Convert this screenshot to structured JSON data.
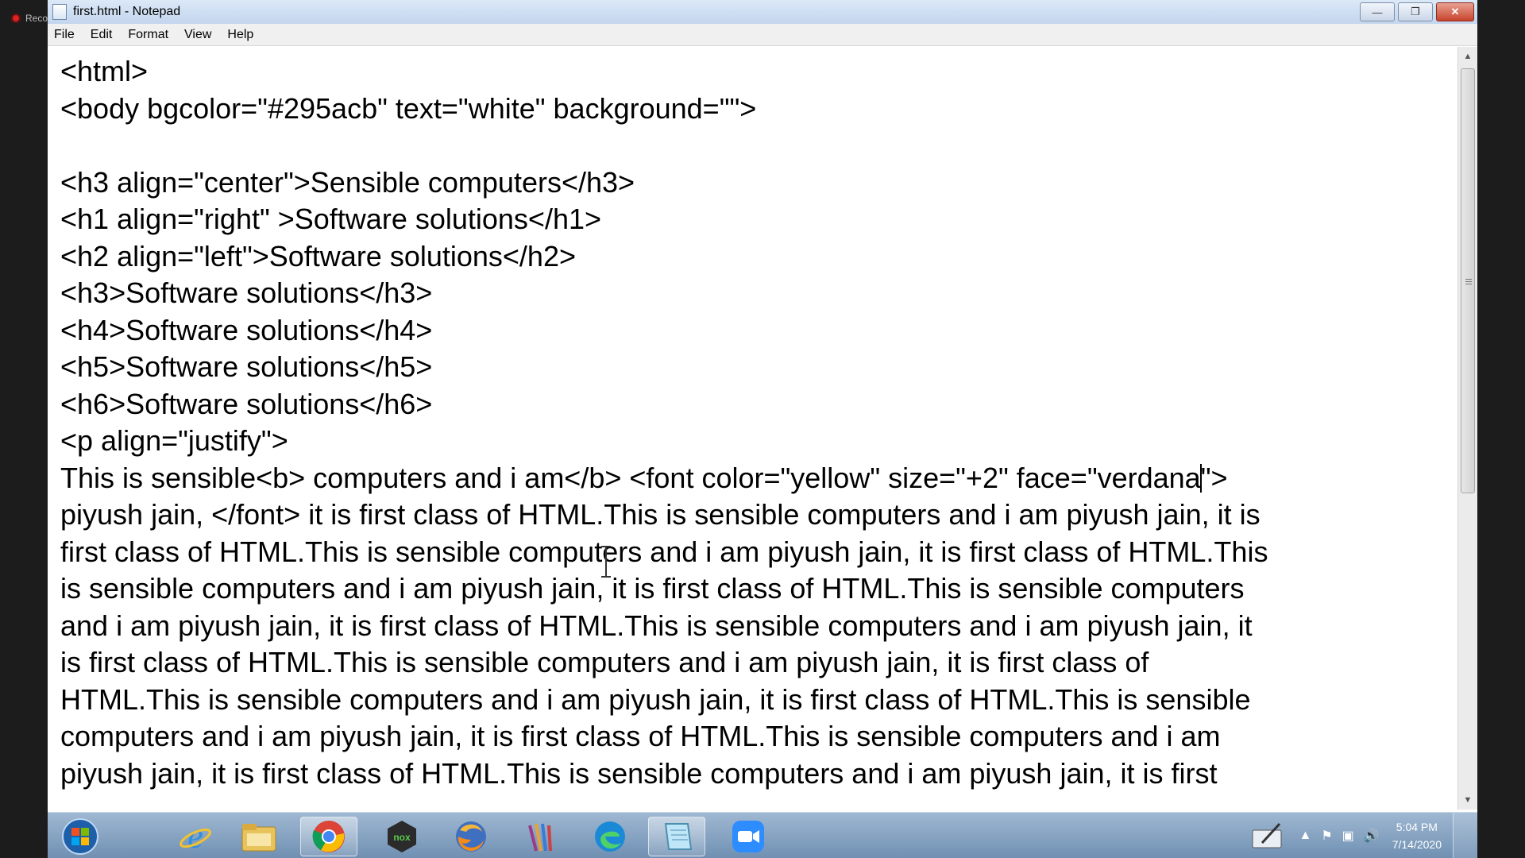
{
  "recording": {
    "label": "Recording"
  },
  "window": {
    "title": "first.html - Notepad",
    "controls": {
      "minimize": "—",
      "restore": "❐",
      "close": "✕"
    }
  },
  "menu": [
    "File",
    "Edit",
    "Format",
    "View",
    "Help"
  ],
  "editor": {
    "lines": [
      "<html>",
      "<body bgcolor=\"#295acb\" text=\"white\" background=\"\">",
      "",
      "<h3 align=\"center\">Sensible computers</h3>",
      "<h1 align=\"right\" >Software solutions</h1>",
      "<h2 align=\"left\">Software solutions</h2>",
      "<h3>Software solutions</h3>",
      "<h4>Software solutions</h4>",
      "<h5>Software solutions</h5>",
      "<h6>Software solutions</h6>",
      "<p align=\"justify\">"
    ],
    "caret_line": {
      "before_caret": "This is sensible<b> computers and i am</b> <font color=\"yellow\" size=\"+2\" face=\"verdana",
      "after_caret": "\">"
    },
    "wrapped_lines": [
      "piyush jain, </font> it is first class of HTML.This is sensible computers and i am piyush jain, it is",
      "first class of HTML.This is sensible computers and i am piyush jain, it is first class of HTML.This",
      "is sensible computers and i am piyush jain, it is first class of HTML.This is sensible computers",
      "and i am piyush jain, it is first class of HTML.This is sensible computers and i am piyush jain, it",
      "is first class of HTML.This is sensible computers and i am piyush jain, it is first class of",
      "HTML.This is sensible computers and i am piyush jain, it is first class of HTML.This is sensible",
      "computers and i am piyush jain, it is first class of HTML.This is sensible computers and i am",
      "piyush jain, it is first class of HTML.This is sensible computers and i am piyush jain, it is first"
    ]
  },
  "taskbar": {
    "apps": [
      {
        "name": "start-orb-icon"
      },
      {
        "name": "internet-explorer-icon"
      },
      {
        "name": "file-explorer-icon"
      },
      {
        "name": "chrome-icon",
        "active": true
      },
      {
        "name": "nox-player-icon"
      },
      {
        "name": "firefox-icon"
      },
      {
        "name": "winrar-icon"
      },
      {
        "name": "edge-icon"
      },
      {
        "name": "notepad-icon",
        "active": true
      },
      {
        "name": "zoom-icon"
      }
    ],
    "clock": {
      "time": "5:04 PM",
      "date": "7/14/2020"
    }
  },
  "colors": {
    "titlebar": "#c3d6ee",
    "taskbar": "#7f9dbd",
    "close": "#c7432c"
  }
}
